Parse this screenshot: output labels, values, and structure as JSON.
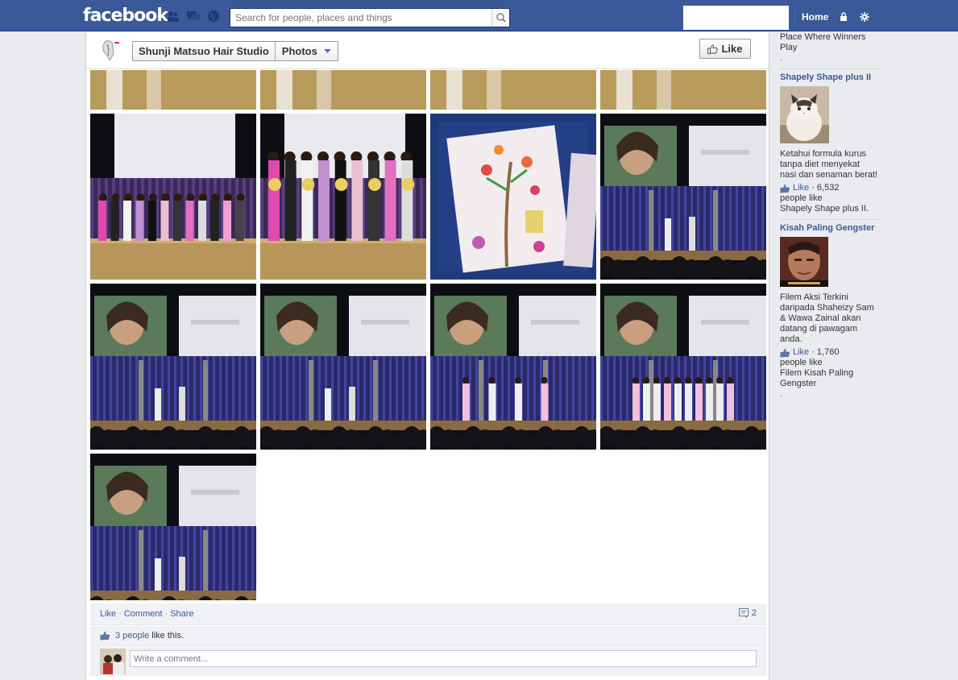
{
  "topbar": {
    "logo": "facebook",
    "search_placeholder": "Search for people, places and things",
    "home": "Home"
  },
  "page_header": {
    "page_name": "Shunji Matsuo Hair Studio",
    "section": "Photos",
    "like_button": "Like"
  },
  "photos": [
    {
      "kind": "partial",
      "hint": "stage"
    },
    {
      "kind": "partial",
      "hint": "stage"
    },
    {
      "kind": "partial",
      "hint": "stage"
    },
    {
      "kind": "partial",
      "hint": "stage"
    },
    {
      "kind": "stage-lineup"
    },
    {
      "kind": "stage-bouquets"
    },
    {
      "kind": "drawing"
    },
    {
      "kind": "screen-portrait"
    },
    {
      "kind": "screen-portrait"
    },
    {
      "kind": "screen-portrait"
    },
    {
      "kind": "screen-models"
    },
    {
      "kind": "screen-lineup"
    },
    {
      "kind": "screen-portrait"
    }
  ],
  "footer": {
    "actions": [
      "Like",
      "Comment",
      "Share"
    ],
    "comment_count": "2",
    "likes_link": "3 people",
    "likes_text": "like this.",
    "comment_placeholder": "Write a comment..."
  },
  "sidebar": {
    "top_lines": [
      "Place Where Winners",
      "Play",
      "."
    ],
    "ads": [
      {
        "title": "Shapely Shape plus II",
        "body": "Ketahui formula kurus tanpa diet menyekat nasi dan senaman berat!",
        "like_label": "Like",
        "like_count": "· 6,532",
        "people_line": "people like",
        "people_target": "Shapely Shape plus II.",
        "thumb": "cat"
      },
      {
        "title": "Kisah Paling Gengster",
        "body": "Filem Aksi Terkini daripada Shaheizy Sam & Wawa Zainal akan datang di pawagam anda.",
        "like_label": "Like",
        "like_count": "· 1,760",
        "people_line": "people like",
        "people_target": "Filem Kisah Paling Gengster",
        "trailing": ".",
        "thumb": "poster"
      }
    ]
  },
  "colors": {
    "brand": "#3b5998",
    "link": "#3b5998",
    "panel": "#eff1f5"
  }
}
